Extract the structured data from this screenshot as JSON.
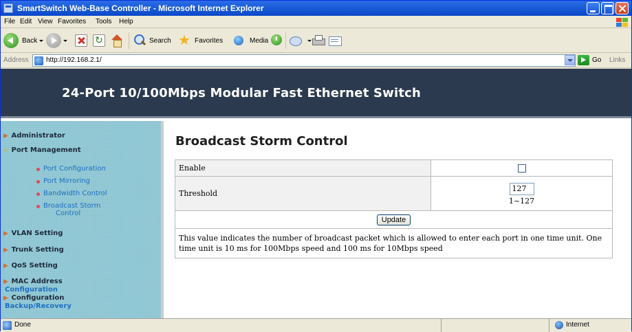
{
  "window": {
    "title": "SmartSwitch Web-Base Controller - Microsoft Internet Explorer"
  },
  "menu": [
    "File",
    "Edit",
    "View",
    "Favorites",
    "Tools",
    "Help"
  ],
  "toolbar": {
    "back_label": "Back",
    "search_label": "Search",
    "favorites_label": "Favorites",
    "media_label": "Media"
  },
  "address": {
    "label": "Address",
    "url": "http://192.168.2.1/",
    "go_label": "Go",
    "links_label": "Links"
  },
  "banner": {
    "title": "24-Port 10/100Mbps Modular Fast Ethernet Switch"
  },
  "sidebar": {
    "administrator": "Administrator",
    "port_management": "Port Management",
    "sub_items": [
      "Port Configuration",
      "Port Mirroring",
      "Bandwidth Control",
      "Broadcast Storm",
      "Control"
    ],
    "vlan": "VLAN Setting",
    "trunk": "Trunk Setting",
    "qos": "QoS Setting",
    "mac": "MAC Address",
    "mac_link": "Configuration",
    "config": "Configuration",
    "backup_link": "Backup/Recovery"
  },
  "content": {
    "title": "Broadcast Storm Control",
    "enable_label": "Enable",
    "enable_checked": false,
    "threshold_label": "Threshold",
    "threshold_value": "127",
    "threshold_range": "1~127",
    "update_label": "Update",
    "description": "This value indicates the number of broadcast packet which is allowed to enter each port in one time unit. One time unit is 10 ms for 100Mbps speed and 100 ms for 10Mbps speed"
  },
  "status": {
    "text": "Done",
    "zone": "Internet"
  },
  "icons": [
    "window-icon",
    "windows-logo-icon",
    "back-icon",
    "forward-icon",
    "stop-icon",
    "refresh-icon",
    "home-icon",
    "search-icon",
    "favorites-icon",
    "media-icon",
    "history-icon",
    "mail-icon",
    "print-icon",
    "edit-icon",
    "page-icon",
    "go-icon",
    "globe-icon"
  ]
}
